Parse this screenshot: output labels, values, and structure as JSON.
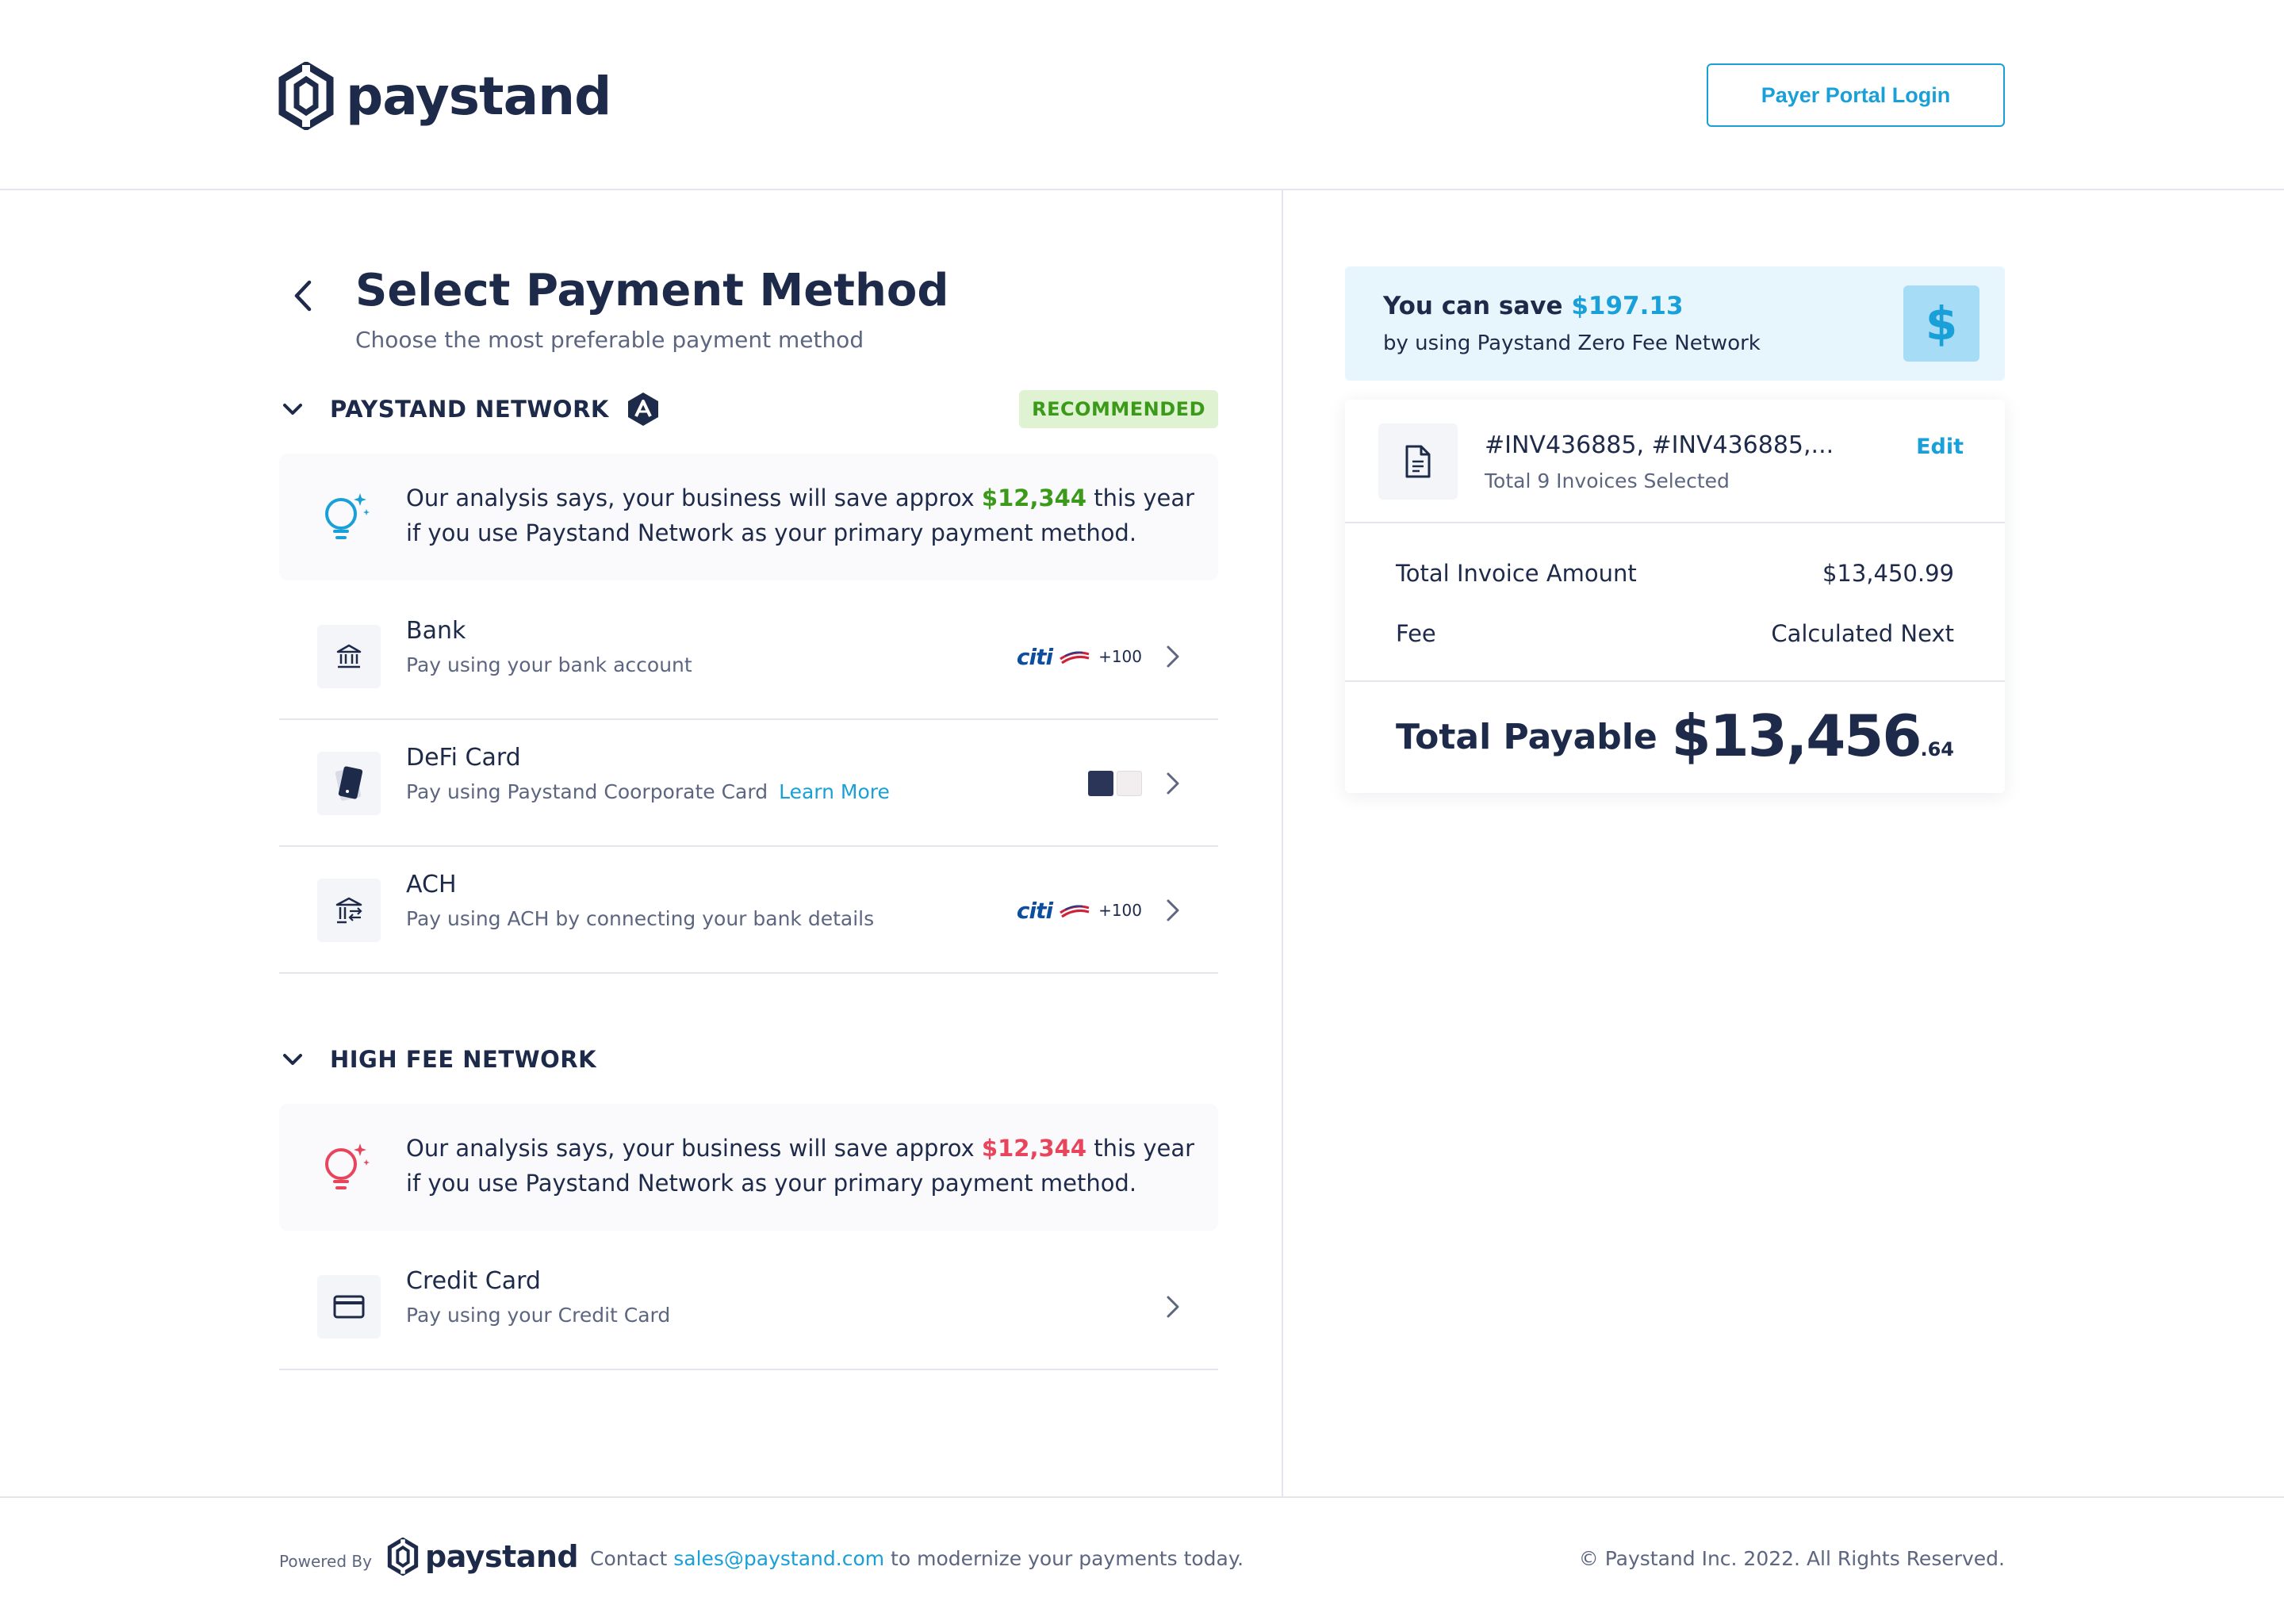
{
  "header": {
    "brand": "paystand",
    "portal_button": "Payer Portal Login"
  },
  "page": {
    "title": "Select Payment Method",
    "subtitle": "Choose the most preferable payment method"
  },
  "paystand_network": {
    "label": "PAYSTAND NETWORK",
    "badge": "RECOMMENDED",
    "analysis": {
      "before": "Our analysis says, your business will save approx ",
      "amount": "$12,344",
      "after": " this year if you use Paystand Network as your primary payment method."
    },
    "methods": [
      {
        "title": "Bank",
        "subtitle": "Pay using your bank account",
        "logo_text": "citi",
        "extra": "+100"
      },
      {
        "title": "DeFi Card",
        "subtitle": "Pay using Paystand Coorporate Card",
        "link": "Learn More"
      },
      {
        "title": "ACH",
        "subtitle": "Pay using ACH by connecting your bank details",
        "logo_text": "citi",
        "extra": "+100"
      }
    ]
  },
  "high_fee_network": {
    "label": "HIGH FEE NETWORK",
    "analysis": {
      "before": "Our analysis says, your business will save approx ",
      "amount": "$12,344",
      "after": " this year if you use Paystand Network as your primary payment method."
    },
    "methods": [
      {
        "title": "Credit Card",
        "subtitle": "Pay using your Credit Card"
      }
    ]
  },
  "savings": {
    "prefix": "You can save ",
    "amount": "$197.13",
    "line2": "by using Paystand Zero Fee Network",
    "icon_glyph": "$"
  },
  "summary": {
    "invoice_ids": "#INV436885, #INV436885,...",
    "invoice_count": "Total 9 Invoices Selected",
    "edit": "Edit",
    "total_invoice_label": "Total Invoice Amount",
    "total_invoice_value": "$13,450.99",
    "fee_label": "Fee",
    "fee_value": "Calculated Next",
    "total_label": "Total Payable",
    "total_major": "$13,456",
    "total_minor": ".64"
  },
  "footer": {
    "powered_by": "Powered By",
    "brand": "paystand",
    "contact_before": "Contact ",
    "contact_email": "sales@paystand.com",
    "contact_after": " to modernize your payments today.",
    "copyright": "© Paystand Inc. 2022. All Rights Reserved."
  },
  "colors": {
    "navy": "#1e2a4a",
    "accent_blue": "#1aa0d8",
    "green": "#3c9a1a",
    "red": "#e8455c"
  }
}
